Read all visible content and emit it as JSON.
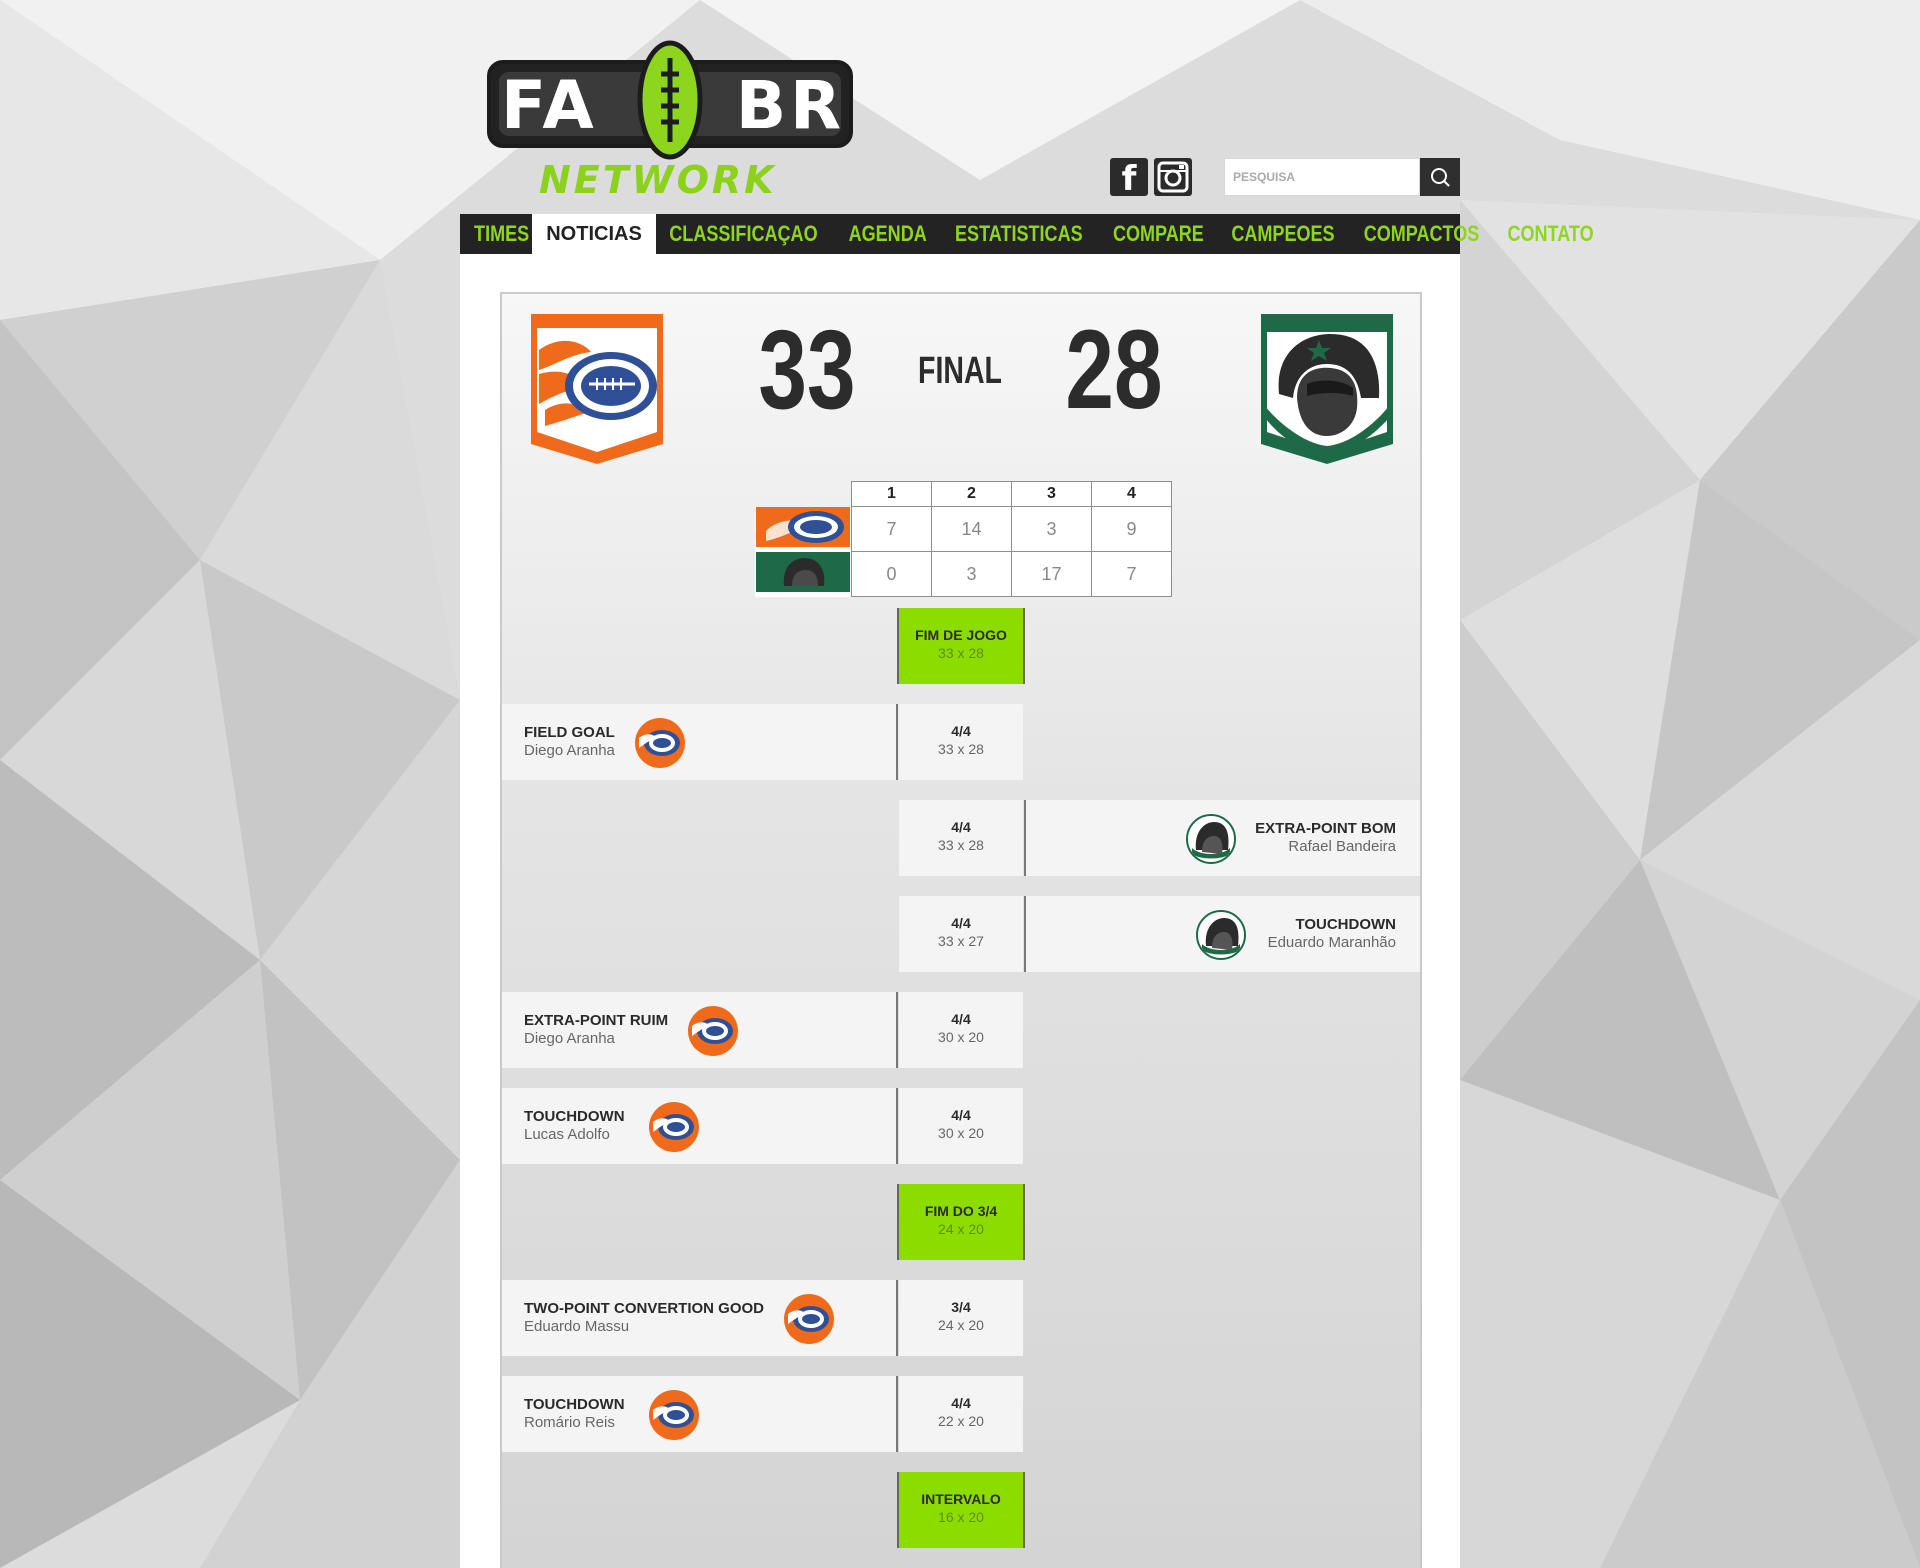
{
  "brand": {
    "name_left": "FA",
    "name_right": "BR",
    "network": "NETWORK",
    "accent": "#8ed61e"
  },
  "header": {
    "social": [
      {
        "icon": "facebook-icon",
        "glyph": "f"
      },
      {
        "icon": "instagram-icon"
      }
    ],
    "search": {
      "placeholder": "PESQUISA",
      "icon": "search-icon"
    }
  },
  "nav": {
    "items": [
      "TIMES",
      "NOTICIAS",
      "CLASSIFICAÇAO",
      "AGENDA",
      "ESTATISTICAS",
      "COMPARE",
      "CAMPEOES",
      "COMPACTOS",
      "CONTATO"
    ],
    "active": "NOTICIAS"
  },
  "game": {
    "home": {
      "score": "33",
      "color": "#f26a1b"
    },
    "away": {
      "score": "28",
      "color": "#1f6a46"
    },
    "status": "FINAL",
    "quarters": {
      "headers": [
        "1",
        "2",
        "3",
        "4"
      ],
      "home": [
        "7",
        "14",
        "3",
        "9"
      ],
      "away": [
        "0",
        "3",
        "17",
        "7"
      ]
    }
  },
  "timeline": [
    {
      "side": "center",
      "title": "FIM DE JOGO",
      "score": "33 x 28"
    },
    {
      "side": "left",
      "title": "FIELD GOAL",
      "player": "Diego Aranha",
      "quarter": "4/4",
      "score": "33 x 28"
    },
    {
      "side": "right",
      "title": "EXTRA-POINT BOM",
      "player": "Rafael Bandeira",
      "quarter": "4/4",
      "score": "33 x 28"
    },
    {
      "side": "right",
      "title": "TOUCHDOWN",
      "player": "Eduardo Maranhão",
      "quarter": "4/4",
      "score": "33 x 27"
    },
    {
      "side": "left",
      "title": "EXTRA-POINT RUIM",
      "player": "Diego Aranha",
      "quarter": "4/4",
      "score": "30 x 20"
    },
    {
      "side": "left",
      "title": "TOUCHDOWN",
      "player": "Lucas Adolfo",
      "quarter": "4/4",
      "score": "30 x 20"
    },
    {
      "side": "center",
      "title": "FIM DO 3/4",
      "score": "24 x 20"
    },
    {
      "side": "left",
      "title": "TWO-POINT CONVERTION GOOD",
      "player": "Eduardo Massu",
      "quarter": "3/4",
      "score": "24 x 20"
    },
    {
      "side": "left",
      "title": "TOUCHDOWN",
      "player": "Romário Reis",
      "quarter": "4/4",
      "score": "22 x 20"
    },
    {
      "side": "center",
      "title": "INTERVALO",
      "score": "16 x 20"
    }
  ]
}
